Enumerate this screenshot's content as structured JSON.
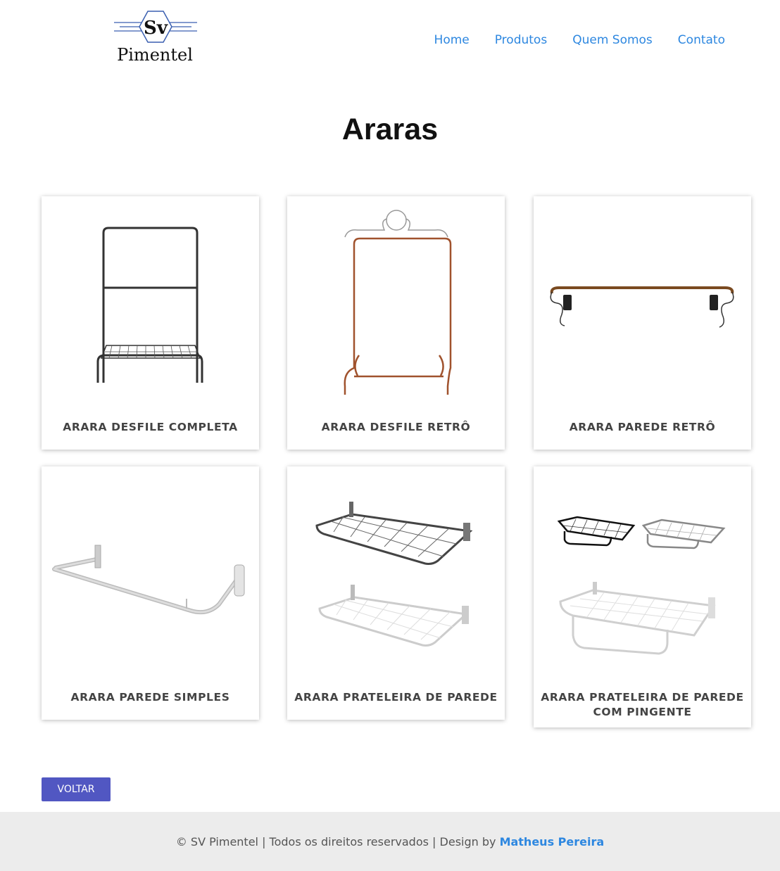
{
  "header": {
    "logo_mark": "Sv",
    "logo_text": "Pimentel",
    "nav": [
      {
        "label": "Home"
      },
      {
        "label": "Produtos"
      },
      {
        "label": "Quem Somos"
      },
      {
        "label": "Contato"
      }
    ]
  },
  "page": {
    "title": "Araras"
  },
  "products": [
    {
      "name": "ARARA DESFILE COMPLETA",
      "icon": "clothes-rack-black-image"
    },
    {
      "name": "ARARA DESFILE RETRÔ",
      "icon": "clothes-rack-copper-image"
    },
    {
      "name": "ARARA PAREDE RETRÔ",
      "icon": "wall-bar-retro-image"
    },
    {
      "name": "ARARA PAREDE SIMPLES",
      "icon": "wall-bar-simple-image"
    },
    {
      "name": "ARARA PRATELEIRA DE PAREDE",
      "icon": "wall-shelf-image"
    },
    {
      "name": "ARARA PRATELEIRA DE PAREDE COM PINGENTE",
      "icon": "wall-shelf-pendant-image"
    }
  ],
  "actions": {
    "back_label": "VOLTAR"
  },
  "footer": {
    "text": "© SV Pimentel | Todos os direitos reservados | Design by ",
    "author": "Matheus Pereira"
  },
  "colors": {
    "link": "#2d87e0",
    "button": "#5157c2",
    "footer_bg": "#ececec"
  }
}
